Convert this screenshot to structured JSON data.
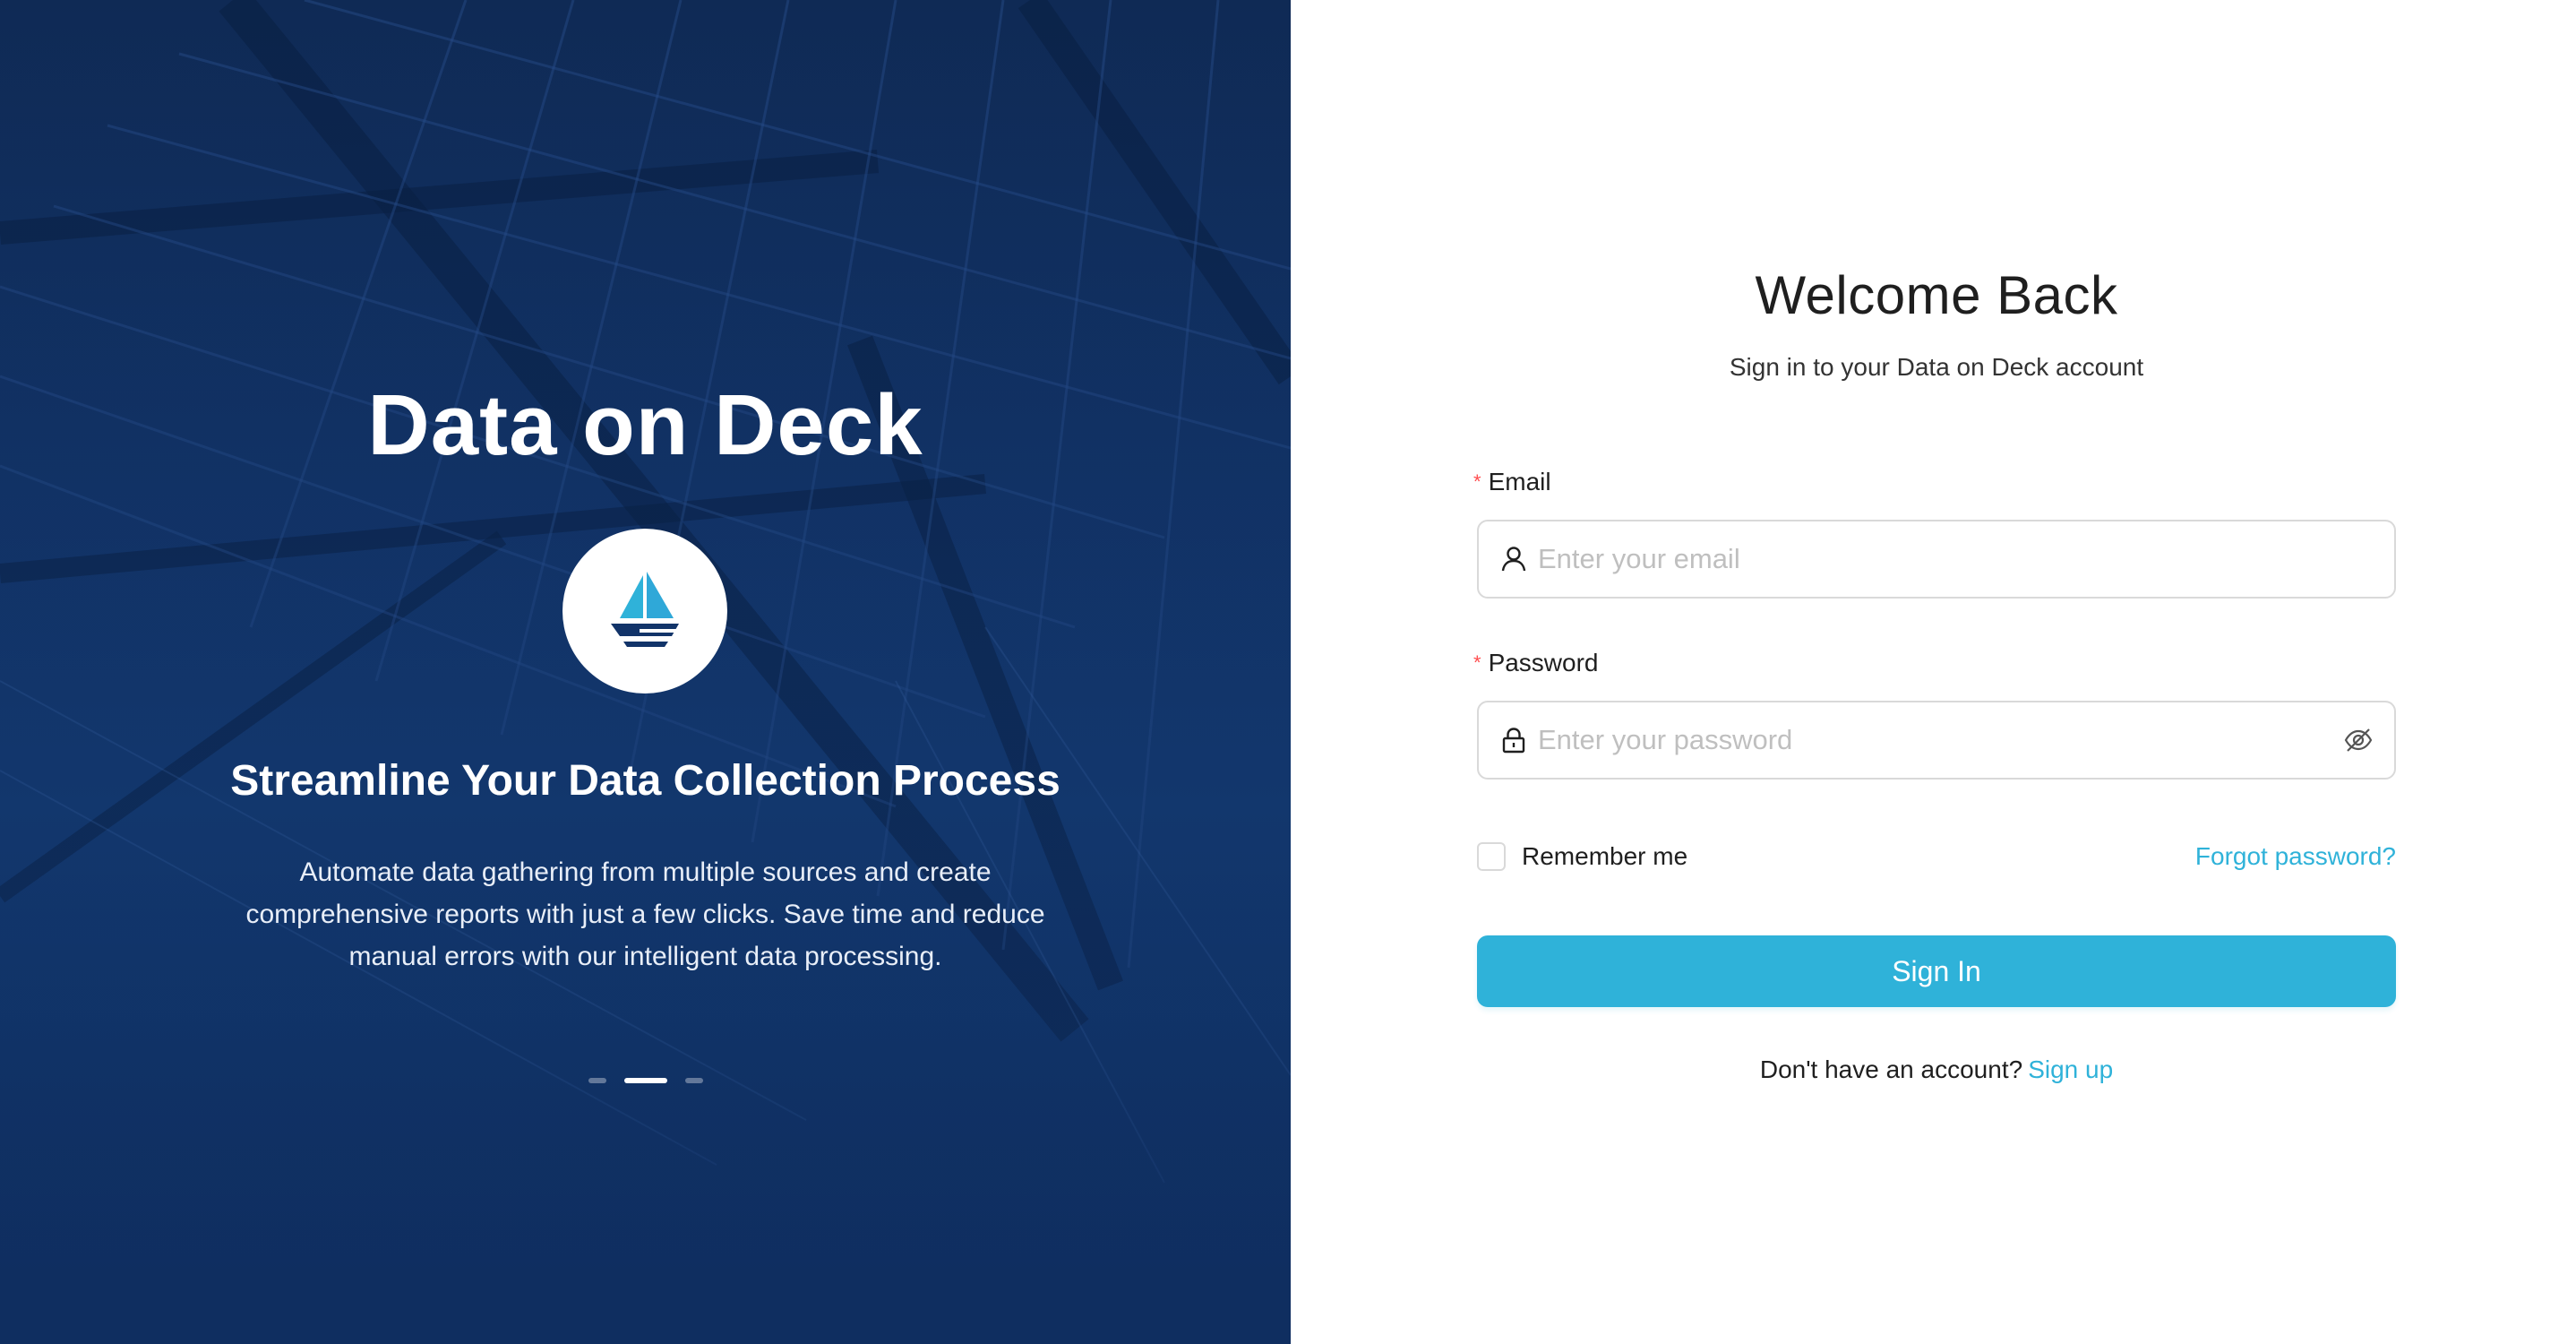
{
  "brand": {
    "title": "Data on Deck",
    "logo_icon": "sailboat-icon",
    "tagline": "Streamline Your Data Collection Process",
    "description": "Automate data gathering from multiple sources and create comprehensive reports with just a few clicks. Save time and reduce manual errors with our intelligent data processing.",
    "carousel": {
      "slides": 3,
      "active_index": 1
    }
  },
  "login": {
    "heading": "Welcome Back",
    "subtitle": "Sign in to your Data on Deck account",
    "required_mark": "*",
    "email": {
      "label": "Email",
      "placeholder": "Enter your email",
      "value": "",
      "icon": "user-icon"
    },
    "password": {
      "label": "Password",
      "placeholder": "Enter your password",
      "value": "",
      "icon": "lock-icon",
      "toggle_icon": "eye-off-icon"
    },
    "remember_label": "Remember me",
    "remember_checked": false,
    "forgot_label": "Forgot password?",
    "submit_label": "Sign In",
    "signup_prompt": "Don't have an account?",
    "signup_link": "Sign up"
  },
  "colors": {
    "accent": "#2fb2d9",
    "panel_dark": "#123469",
    "required": "#ff4d4f"
  }
}
